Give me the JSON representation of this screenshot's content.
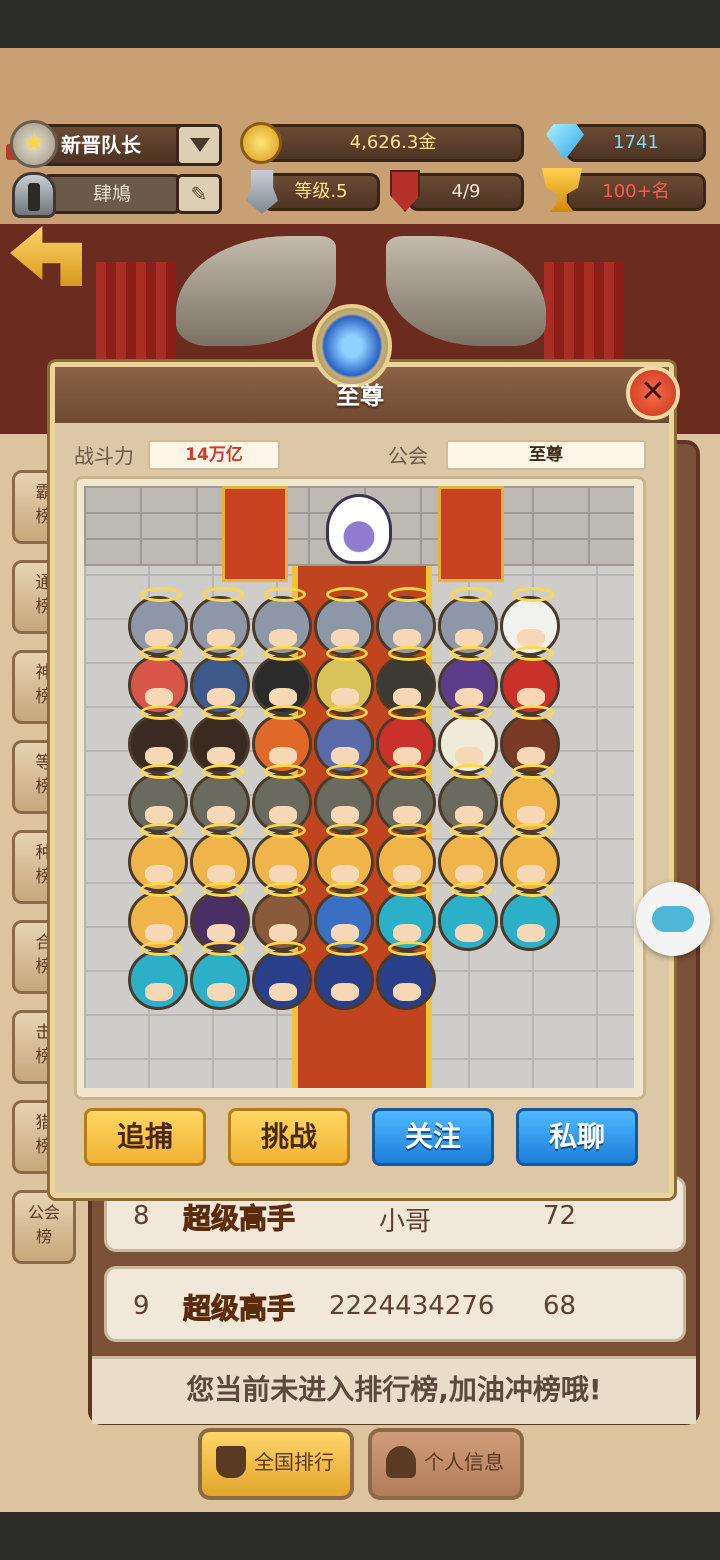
{
  "hud": {
    "player_name": "新晋队长",
    "alias": "肆鳩",
    "gold": "4,626.3金",
    "gems": "1741",
    "level": "等级.5",
    "battle_count": "4/9",
    "rank": "100+名"
  },
  "side_tabs": [
    {
      "label": "霸\n榜"
    },
    {
      "label": "通\n榜"
    },
    {
      "label": "神\n榜"
    },
    {
      "label": "等\n榜"
    },
    {
      "label": "种\n榜"
    },
    {
      "label": "合\n榜"
    },
    {
      "label": "击\n榜"
    },
    {
      "label": "猎\n榜"
    },
    {
      "label": "公会\n榜"
    }
  ],
  "rank_rows": [
    {
      "num": "8",
      "title": "超级高手",
      "name": "小哥",
      "level": "72"
    },
    {
      "num": "9",
      "title": "超级高手",
      "name": "2224434276",
      "level": "68"
    }
  ],
  "notice": "您当前未进入排行榜,加油冲榜哦!",
  "bottom_tabs": {
    "national": "全国排行",
    "personal": "个人信息"
  },
  "modal": {
    "title": "至尊",
    "power_label": "战斗力",
    "power_value": "14万亿",
    "guild_label": "公会",
    "guild_value": "至尊",
    "buttons": {
      "chase": "追捕",
      "challenge": "挑战",
      "follow": "关注",
      "chat": "私聊"
    }
  },
  "colors": {
    "accent_yellow": "#f0b336",
    "accent_blue": "#1f7ed8",
    "power_red": "#d23a2a",
    "carpet": "#c0451f"
  },
  "icons": [
    "star-icon",
    "chevron-down-icon",
    "helmet-icon",
    "pencil-icon",
    "gold-coin-icon",
    "diamond-icon",
    "medal-icon",
    "crossed-swords-icon",
    "trophy-icon",
    "back-arrow-icon",
    "close-icon",
    "gamepad-icon",
    "person-icon"
  ]
}
